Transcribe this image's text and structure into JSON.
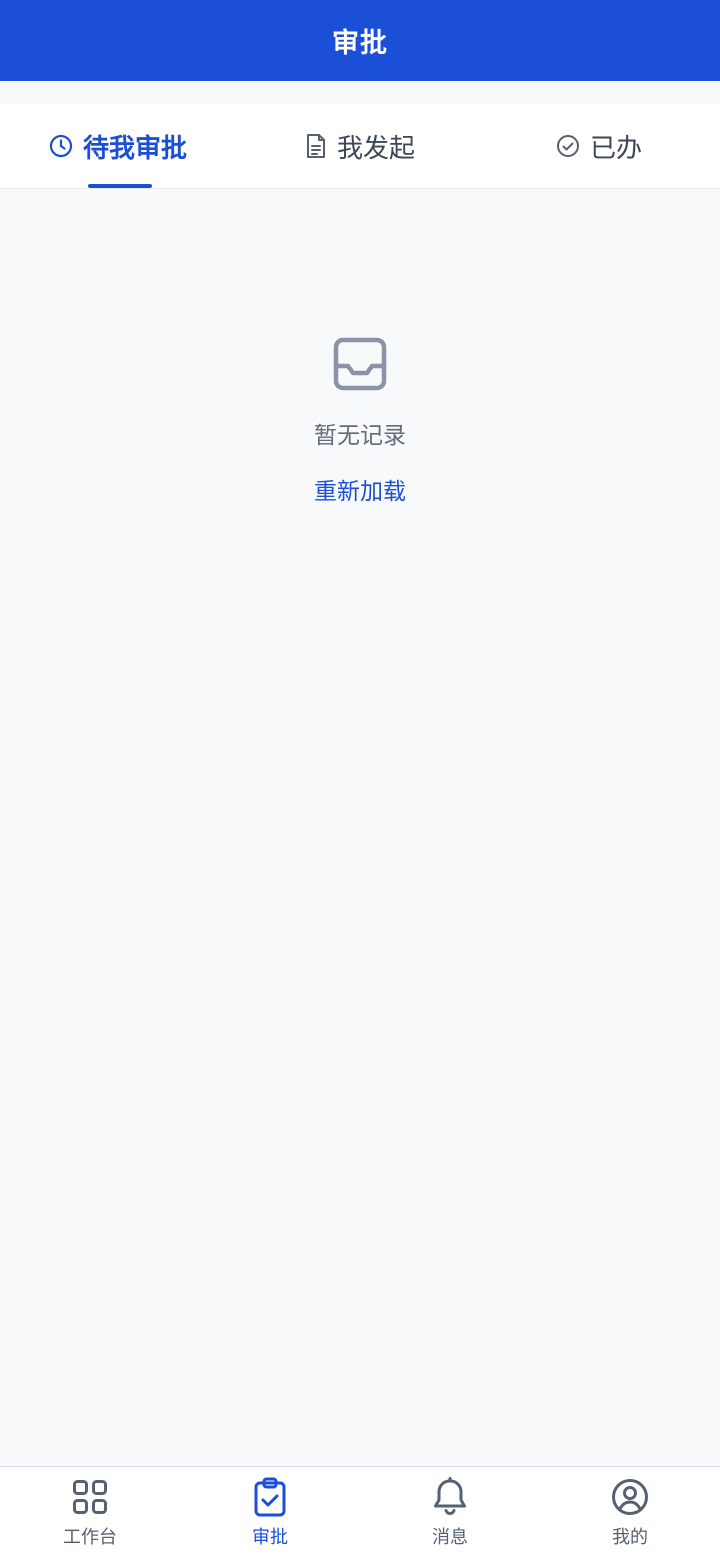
{
  "header": {
    "title": "审批"
  },
  "tabs": [
    {
      "label": "待我审批",
      "icon": "clock-icon",
      "active": true
    },
    {
      "label": "我发起",
      "icon": "document-icon",
      "active": false
    },
    {
      "label": "已办",
      "icon": "check-circle-icon",
      "active": false
    }
  ],
  "empty_state": {
    "icon": "inbox-icon",
    "message": "暂无记录",
    "reload_label": "重新加载"
  },
  "bottom_nav": [
    {
      "label": "工作台",
      "icon": "grid-icon",
      "active": false
    },
    {
      "label": "审批",
      "icon": "clipboard-check-icon",
      "active": true
    },
    {
      "label": "消息",
      "icon": "bell-icon",
      "active": false
    },
    {
      "label": "我的",
      "icon": "user-circle-icon",
      "active": false
    }
  ],
  "colors": {
    "primary": "#1c4fd8",
    "background": "#f7f9fb",
    "text_secondary": "#626b78",
    "icon_gray": "#8a94a6"
  }
}
